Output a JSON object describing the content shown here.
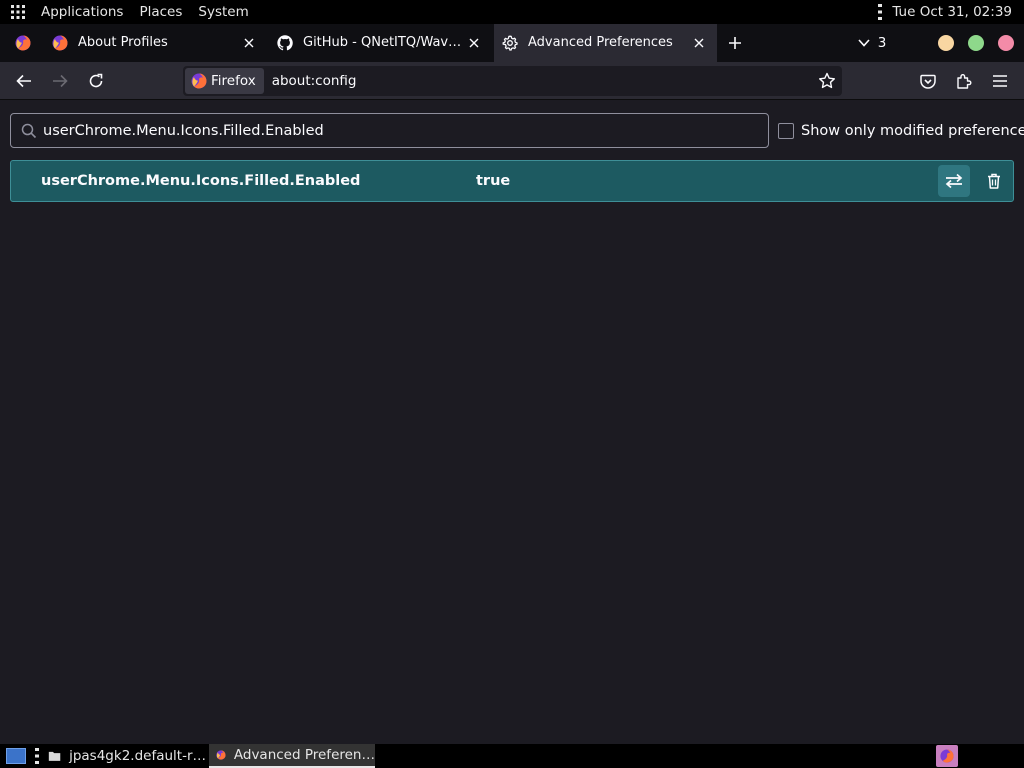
{
  "panel": {
    "menu_items": [
      "Applications",
      "Places",
      "System"
    ],
    "clock": "Tue Oct 31, 02:39"
  },
  "tabs": [
    {
      "title": "About Profiles",
      "icon": "firefox-icon",
      "active": false
    },
    {
      "title": "GitHub - QNetITQ/Wave…",
      "icon": "github-icon",
      "active": false
    },
    {
      "title": "Advanced Preferences",
      "icon": "gear-icon",
      "active": true
    }
  ],
  "tab_strip": {
    "tab_count": "3"
  },
  "window_controls": {
    "colors": [
      "#f8d6a2",
      "#8ed88b",
      "#f38ba8"
    ]
  },
  "nav": {
    "identity_label": "Firefox",
    "url": "about:config"
  },
  "config": {
    "search_value": "userChrome.Menu.Icons.Filled.Enabled",
    "modified_only_label": "Show only modified preferences",
    "modified_only_checked": false,
    "pref": {
      "name": "userChrome.Menu.Icons.Filled.Enabled",
      "value": "true"
    }
  },
  "taskbar": {
    "items": [
      {
        "title": "jpas4gk2.default-r…",
        "icon": "folder-icon",
        "active": false
      },
      {
        "title": "Advanced Preferen…",
        "icon": "firefox-icon",
        "active": true
      }
    ]
  },
  "colors": {
    "page_bg": "#1c1b22",
    "toolbar_bg": "#2b2a33",
    "tabstrip_bg": "#0f0f13",
    "selected_row": "#1d5a61"
  }
}
